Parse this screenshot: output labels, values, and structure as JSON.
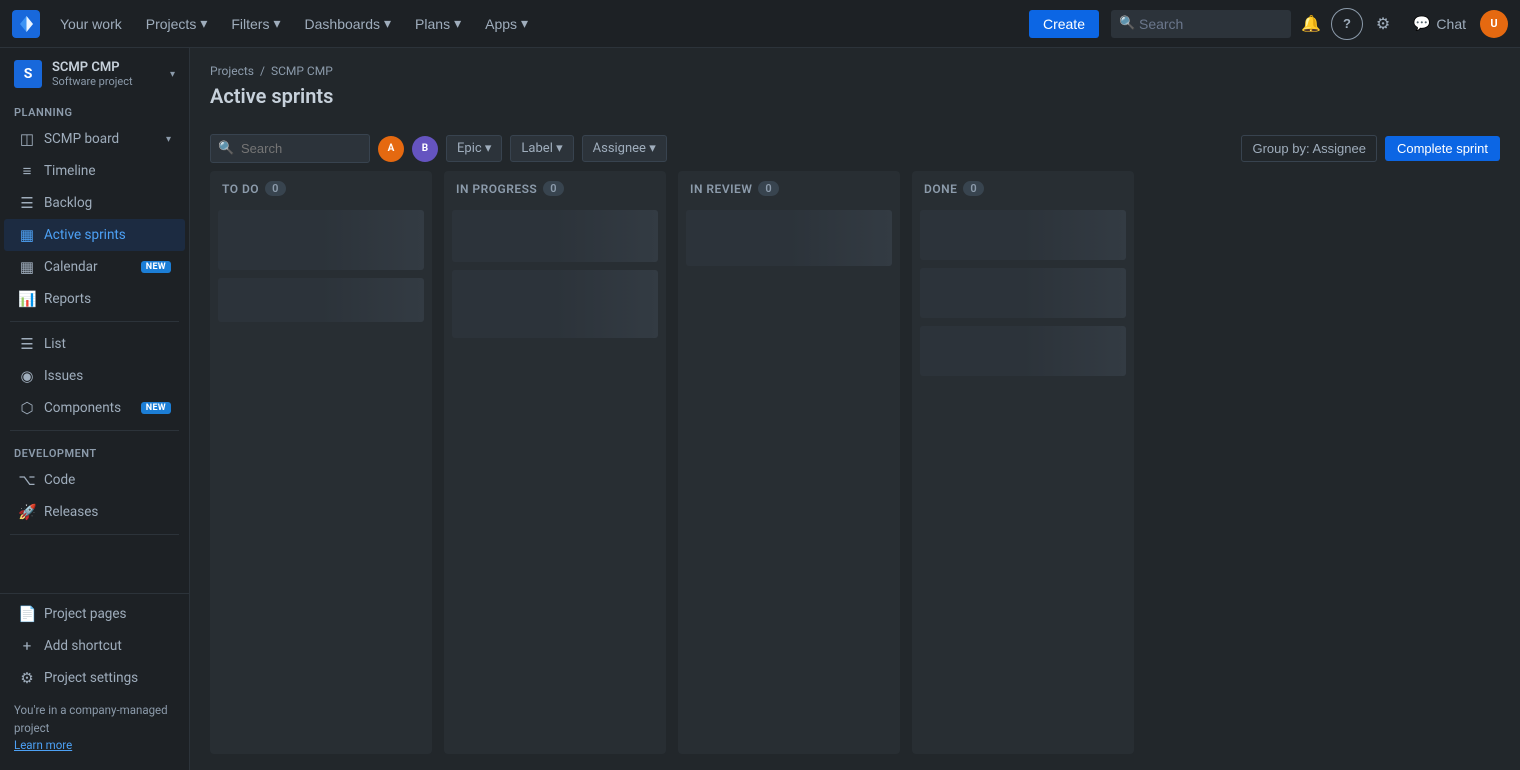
{
  "topnav": {
    "logo_text": "J",
    "your_work_label": "Your work",
    "projects_label": "Projects",
    "filters_label": "Filters",
    "dashboards_label": "Dashboards",
    "plans_label": "Plans",
    "apps_label": "Apps",
    "apps_chevron": "▾",
    "chat_label": "Chat",
    "create_label": "Create",
    "search_placeholder": "Search",
    "notifications_icon": "🔔",
    "help_icon": "?",
    "settings_icon": "⚙",
    "avatar_initials": "U"
  },
  "sidebar": {
    "project_name": "SCMP CMP",
    "project_type": "Software project",
    "project_icon_text": "S",
    "planning_label": "PLANNING",
    "items": [
      {
        "id": "scmp-board",
        "label": "SCMP board",
        "icon": "◫",
        "badge": "",
        "active": false,
        "has_chevron": true
      },
      {
        "id": "timeline",
        "label": "Timeline",
        "icon": "≡",
        "badge": "",
        "active": false
      },
      {
        "id": "backlog",
        "label": "Backlog",
        "icon": "☰",
        "badge": "",
        "active": false
      },
      {
        "id": "active-sprints",
        "label": "Active sprints",
        "icon": "▦",
        "badge": "",
        "active": true
      },
      {
        "id": "calendar",
        "label": "Calendar",
        "icon": "📅",
        "badge": "NEW",
        "active": false
      },
      {
        "id": "reports",
        "label": "Reports",
        "icon": "📊",
        "badge": "",
        "active": false
      }
    ],
    "development_label": "DEVELOPMENT",
    "dev_items": [
      {
        "id": "list",
        "label": "List",
        "icon": "☰",
        "badge": ""
      },
      {
        "id": "issues",
        "label": "Issues",
        "icon": "◉",
        "badge": ""
      },
      {
        "id": "components",
        "label": "Components",
        "icon": "⬡",
        "badge": "NEW"
      }
    ],
    "development_section_label": "DEVELOPMENT",
    "dev_section_items": [
      {
        "id": "code",
        "label": "Code",
        "icon": "⌥"
      },
      {
        "id": "releases",
        "label": "Releases",
        "icon": "🚀"
      }
    ],
    "bottom_items": [
      {
        "id": "project-pages",
        "label": "Project pages",
        "icon": "📄"
      },
      {
        "id": "add-shortcut",
        "label": "Add shortcut",
        "icon": "+"
      },
      {
        "id": "project-settings",
        "label": "Project settings",
        "icon": "⚙"
      }
    ],
    "footer_text": "You're in a company-managed project",
    "learn_more_label": "Learn more"
  },
  "board": {
    "breadcrumb_projects": "Projects",
    "breadcrumb_sep": "/",
    "breadcrumb_project": "SCMP CMP",
    "title": "Active sprints",
    "search_placeholder": "Search",
    "avatar1_initials": "A",
    "avatar2_initials": "B",
    "epic_label": "Epic",
    "label_label": "Label",
    "assignee_label": "Assignee",
    "group_by_label": "Group by: Assignee",
    "complete_sprint_label": "Complete sprint",
    "columns": [
      {
        "id": "todo",
        "label": "TO DO",
        "count": 0
      },
      {
        "id": "inprogress",
        "label": "IN PROGRESS",
        "count": 0
      },
      {
        "id": "review",
        "label": "IN REVIEW",
        "count": 0
      },
      {
        "id": "done",
        "label": "DONE",
        "count": 0
      }
    ]
  }
}
